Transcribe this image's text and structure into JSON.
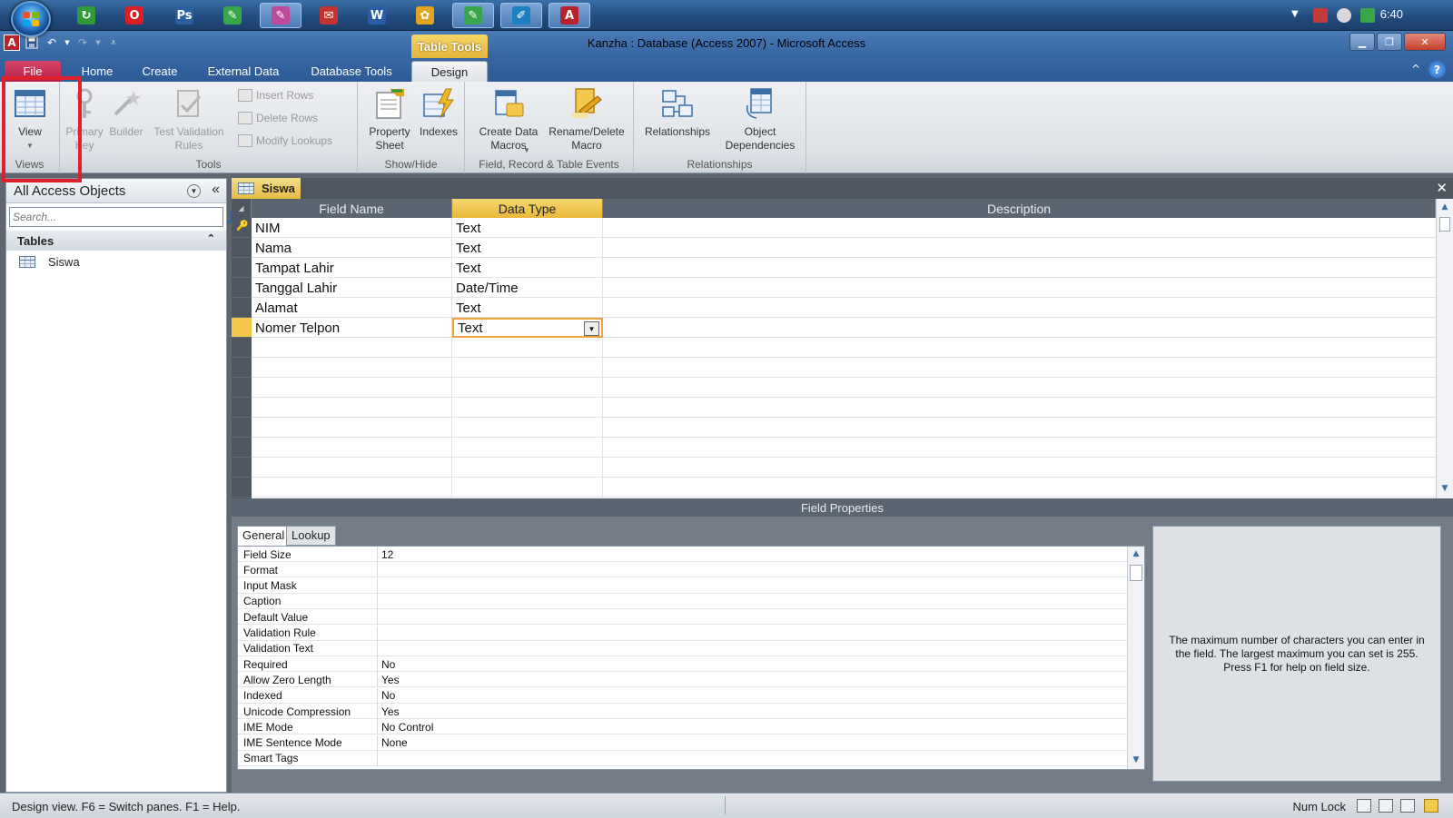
{
  "taskbar": {
    "clock": "6:40",
    "apps": [
      {
        "name": "app-green-icon",
        "glyph": "↻",
        "color": "#2e9a3a"
      },
      {
        "name": "opera-icon",
        "glyph": "O",
        "color": "#d81f26"
      },
      {
        "name": "photoshop-icon",
        "glyph": "Ps",
        "color": "#2b5f9e"
      },
      {
        "name": "app-pen-green-icon",
        "glyph": "✎",
        "color": "#3aa64a"
      },
      {
        "name": "app-pen-pink-icon",
        "glyph": "✎",
        "color": "#c04a9a"
      },
      {
        "name": "app-red-doc-icon",
        "glyph": "✉",
        "color": "#c4332f"
      },
      {
        "name": "word-icon",
        "glyph": "W",
        "color": "#2a5caa"
      },
      {
        "name": "app-yellow-icon",
        "glyph": "✿",
        "color": "#e2a41e"
      },
      {
        "name": "app-pen-green2-icon",
        "glyph": "✎",
        "color": "#3aa64a"
      },
      {
        "name": "app-chat-icon",
        "glyph": "✐",
        "color": "#1d7fbf"
      },
      {
        "name": "access-icon",
        "glyph": "A",
        "color": "#b8222c"
      }
    ]
  },
  "window": {
    "title": "Kanzha : Database (Access 2007)  -  Microsoft Access",
    "context_tab": "Table Tools",
    "logo": "A"
  },
  "ribbon": {
    "tabs": [
      "File",
      "Home",
      "Create",
      "External Data",
      "Database Tools",
      "Design"
    ],
    "active_tab": "Design",
    "groups": {
      "views": {
        "label": "Views",
        "view_button": "View"
      },
      "tools": {
        "label": "Tools",
        "primary_key": "Primary Key",
        "builder": "Builder",
        "test_validation": "Test Validation Rules",
        "insert_rows": "Insert Rows",
        "delete_rows": "Delete Rows",
        "modify_lookups": "Modify Lookups"
      },
      "show_hide": {
        "label": "Show/Hide",
        "property_sheet": "Property Sheet",
        "indexes": "Indexes"
      },
      "events": {
        "label": "Field, Record & Table Events",
        "create_data_macros": "Create Data Macros",
        "rename_delete_macro": "Rename/Delete Macro"
      },
      "relationships": {
        "label": "Relationships",
        "relationships": "Relationships",
        "object_dependencies": "Object Dependencies"
      }
    }
  },
  "nav": {
    "title": "All Access Objects",
    "search_placeholder": "Search...",
    "group_title": "Tables",
    "items": [
      "Siswa"
    ]
  },
  "document": {
    "tab_title": "Siswa",
    "columns": [
      "Field Name",
      "Data Type",
      "Description"
    ],
    "rows": [
      {
        "field": "NIM",
        "type": "Text",
        "primary_key": true
      },
      {
        "field": "Nama",
        "type": "Text"
      },
      {
        "field": "Tampat Lahir",
        "type": "Text"
      },
      {
        "field": "Tanggal Lahir",
        "type": "Date/Time"
      },
      {
        "field": "Alamat",
        "type": "Text"
      },
      {
        "field": "Nomer Telpon",
        "type": "Text",
        "current": true
      }
    ]
  },
  "field_properties": {
    "title": "Field Properties",
    "tabs": [
      "General",
      "Lookup"
    ],
    "active_tab": "General",
    "properties": [
      {
        "label": "Field Size",
        "value": "12"
      },
      {
        "label": "Format",
        "value": ""
      },
      {
        "label": "Input Mask",
        "value": ""
      },
      {
        "label": "Caption",
        "value": ""
      },
      {
        "label": "Default Value",
        "value": ""
      },
      {
        "label": "Validation Rule",
        "value": ""
      },
      {
        "label": "Validation Text",
        "value": ""
      },
      {
        "label": "Required",
        "value": "No"
      },
      {
        "label": "Allow Zero Length",
        "value": "Yes"
      },
      {
        "label": "Indexed",
        "value": "No"
      },
      {
        "label": "Unicode Compression",
        "value": "Yes"
      },
      {
        "label": "IME Mode",
        "value": "No Control"
      },
      {
        "label": "IME Sentence Mode",
        "value": "None"
      },
      {
        "label": "Smart Tags",
        "value": ""
      }
    ],
    "help_text": "The maximum number of characters you can enter in the field. The largest maximum you can set is 255. Press F1 for help on field size."
  },
  "status": {
    "text": "Design view.  F6 = Switch panes.  F1 = Help.",
    "num_lock": "Num Lock"
  },
  "colors": {
    "accent_highlight": "#e0202a",
    "selected_column": "#f2c94c",
    "file_tab": "#c42a52"
  }
}
